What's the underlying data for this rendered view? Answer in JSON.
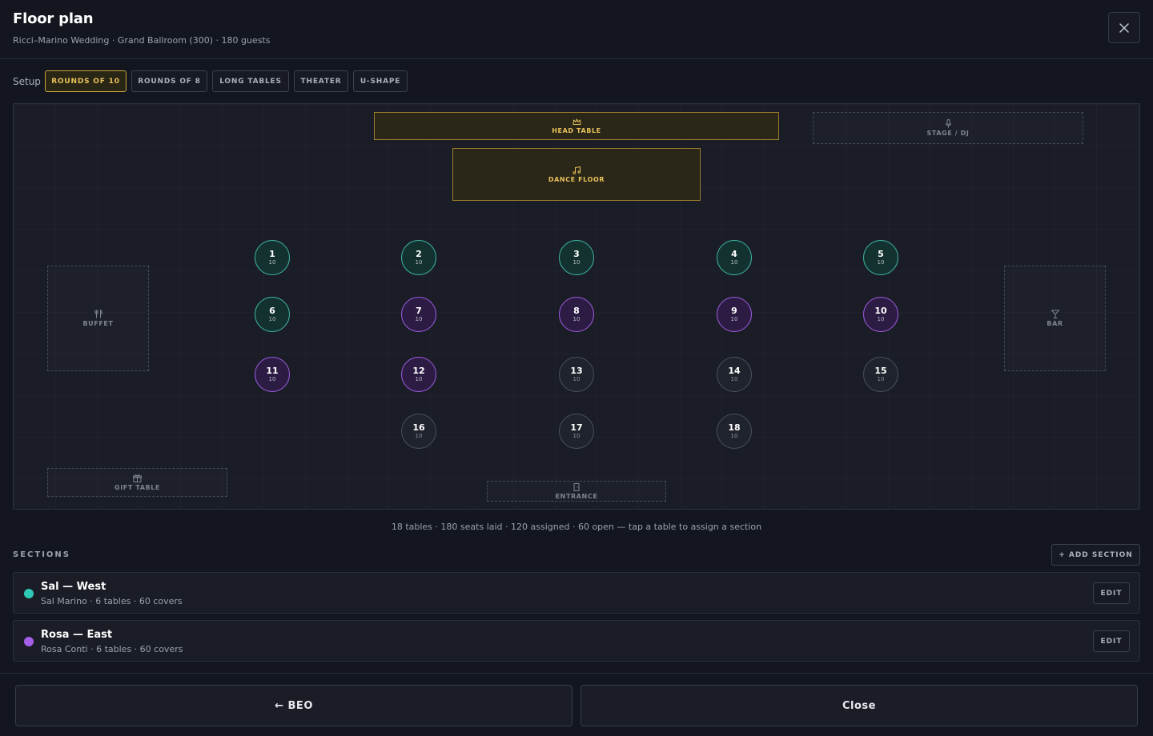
{
  "header": {
    "title": "Floor plan",
    "subtitle": "Ricci–Marino Wedding · Grand Ballroom (300) · 180 guests",
    "close_icon": "close-icon"
  },
  "setup": {
    "label": "Setup",
    "options": [
      "ROUNDS OF 10",
      "ROUNDS OF 8",
      "LONG TABLES",
      "THEATER",
      "U-SHAPE"
    ],
    "selected": "ROUNDS OF 10"
  },
  "floor": {
    "zones": {
      "head_table": "HEAD TABLE",
      "stage": "STAGE / DJ",
      "dance_floor": "DANCE FLOOR",
      "buffet": "BUFFET",
      "bar": "BAR",
      "gift_table": "GIFT TABLE",
      "entrance": "ENTRANCE"
    },
    "tables": [
      {
        "num": "1",
        "seats": "10",
        "section": "teal"
      },
      {
        "num": "2",
        "seats": "10",
        "section": "teal"
      },
      {
        "num": "3",
        "seats": "10",
        "section": "teal"
      },
      {
        "num": "4",
        "seats": "10",
        "section": "teal"
      },
      {
        "num": "5",
        "seats": "10",
        "section": "teal"
      },
      {
        "num": "6",
        "seats": "10",
        "section": "teal"
      },
      {
        "num": "7",
        "seats": "10",
        "section": "purple"
      },
      {
        "num": "8",
        "seats": "10",
        "section": "purple"
      },
      {
        "num": "9",
        "seats": "10",
        "section": "purple"
      },
      {
        "num": "10",
        "seats": "10",
        "section": "purple"
      },
      {
        "num": "11",
        "seats": "10",
        "section": "purple"
      },
      {
        "num": "12",
        "seats": "10",
        "section": "purple"
      },
      {
        "num": "13",
        "seats": "10",
        "section": "open"
      },
      {
        "num": "14",
        "seats": "10",
        "section": "open"
      },
      {
        "num": "15",
        "seats": "10",
        "section": "open"
      },
      {
        "num": "16",
        "seats": "10",
        "section": "open"
      },
      {
        "num": "17",
        "seats": "10",
        "section": "open"
      },
      {
        "num": "18",
        "seats": "10",
        "section": "open"
      }
    ],
    "summary": "18 tables · 180 seats laid · 120 assigned · 60 open — tap a table to assign a section"
  },
  "sections": {
    "title": "SECTIONS",
    "add_label": "+ ADD SECTION",
    "items": [
      {
        "name": "Sal — West",
        "meta": "Sal Marino · 6 tables · 60 covers",
        "color": "#2ec9b4",
        "edit_label": "EDIT"
      },
      {
        "name": "Rosa — East",
        "meta": "Rosa Conti · 6 tables · 60 covers",
        "color": "#a45ee8",
        "edit_label": "EDIT"
      }
    ]
  },
  "footer": {
    "back_label": "← BEO",
    "close_label": "Close"
  },
  "colors": {
    "accent_gold": "#e8c25a",
    "section_teal": "#3fb8a5",
    "section_purple": "#9d5ce0",
    "background": "#13161e"
  }
}
